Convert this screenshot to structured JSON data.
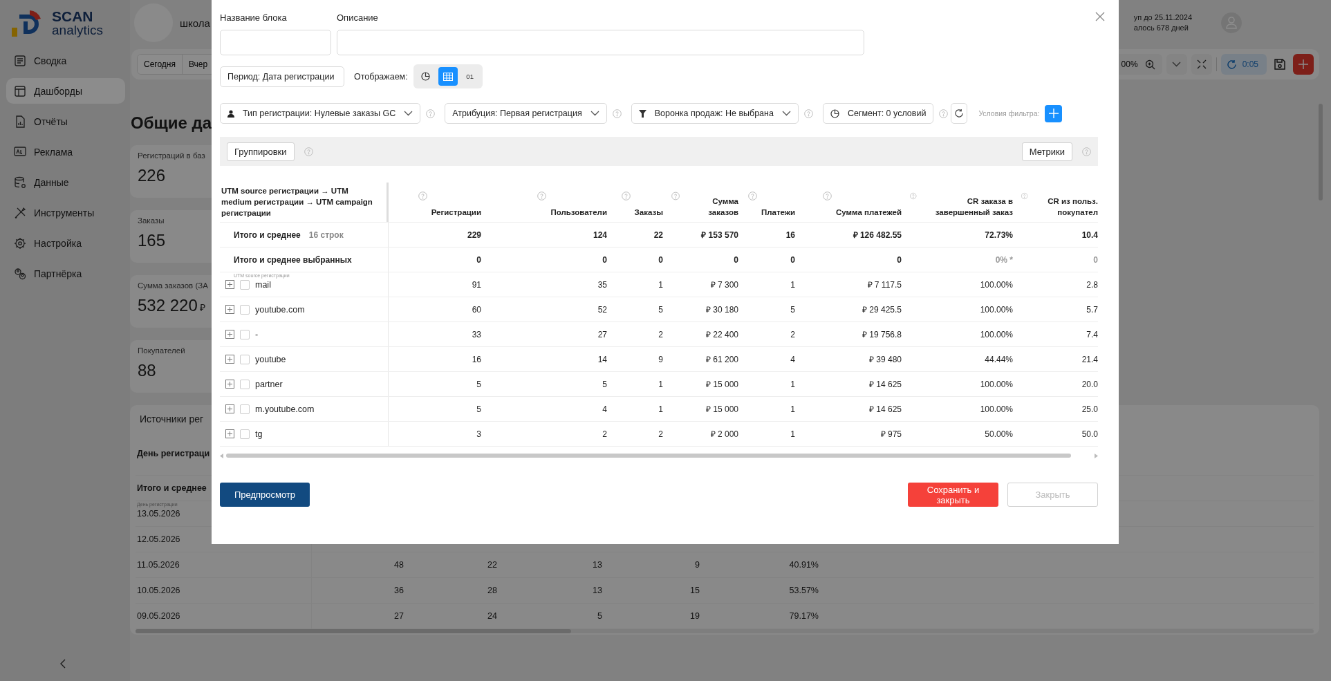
{
  "sidebar": {
    "logo": {
      "title": "SCAN",
      "subtitle": "analytics"
    },
    "items": [
      {
        "label": "Сводка",
        "selected": false
      },
      {
        "label": "Дашборды",
        "selected": true
      },
      {
        "label": "Отчёты",
        "selected": false
      },
      {
        "label": "Реклама",
        "selected": false
      },
      {
        "label": "Данные",
        "selected": false
      },
      {
        "label": "Инструменты",
        "selected": false
      },
      {
        "label": "Настройка",
        "selected": false
      },
      {
        "label": "Партнёрка",
        "selected": false
      }
    ]
  },
  "header": {
    "workspace": "школа",
    "access_lines": [
      "уп до 25.11.2024",
      "алось 678 дней"
    ]
  },
  "toolbar": {
    "periods": [
      "Сегодня",
      "Вчер"
    ],
    "zoom": "00%",
    "refresh_timer": "0:05"
  },
  "page_title": "Общие да",
  "kpi_cards": [
    {
      "label": "Регистраций в баз",
      "value": "226"
    },
    {
      "label": "Заказы",
      "value": "165"
    },
    {
      "label": "Сумма заказов (ЗА",
      "value": "532 220",
      "currency": "₽"
    },
    {
      "label": "Покупателей",
      "value": "88"
    }
  ],
  "sources_table": {
    "title": "Источники рег",
    "header": "День регистраци",
    "total_label": "Итого и среднее",
    "group_caption": "День регистрации",
    "rows": [
      {
        "date": "13.05.2026",
        "values": []
      },
      {
        "date": "12.05.2026",
        "values": []
      },
      {
        "date": "11.05.2026",
        "values": [
          "48",
          "22",
          "13",
          "9",
          "40.91%"
        ]
      },
      {
        "date": "10.05.2026",
        "values": [
          "36",
          "28",
          "13",
          "15",
          "53.57%"
        ]
      },
      {
        "date": "09.05.2026",
        "values": [
          "27",
          "24",
          "5",
          "19",
          "79.17%"
        ]
      }
    ]
  },
  "modal": {
    "name_label": "Название блока",
    "description_label": "Описание",
    "period_dropdown": "Период: Дата регистрации",
    "display": {
      "label": "Отображаем:",
      "options": [
        {
          "kind": "chart",
          "selected": false
        },
        {
          "kind": "table",
          "selected": true
        },
        {
          "kind": "text",
          "label": "01",
          "selected": false
        }
      ]
    },
    "filters": [
      {
        "label": "Тип регистрации: Нулевые заказы GC",
        "dropdown": true
      },
      {
        "label": "Атрибуция: Первая регистрация",
        "dropdown": true
      },
      {
        "label": "Воронка продаж: Не выбрана",
        "dropdown": true
      },
      {
        "label": "Сегмент: 0 условий",
        "dropdown": false
      }
    ],
    "filter_conditions_label": "Условия фильтра:",
    "groupings_button": "Группировки",
    "metrics_button": "Метрики",
    "table": {
      "group_header": "UTM source регистрации → UTM medium регистрации → UTM campaign регистрации",
      "columns": [
        "Регистрации",
        "Пользователи",
        "Заказы",
        "Сумма заказов",
        "Платежи",
        "Сумма платежей",
        "CR заказа в завершенный заказ",
        "CR из польз. покупател"
      ],
      "total_row": {
        "label": "Итого и среднее",
        "count": "16 строк",
        "values": [
          "229",
          "124",
          "22",
          "₽ 153 570",
          "16",
          "₽ 126 482.55",
          "72.73%",
          "10.4"
        ]
      },
      "selected_row": {
        "label": "Итого и среднее выбранных",
        "values": [
          {
            "text": "0",
            "muted": false
          },
          {
            "text": "0",
            "muted": false
          },
          {
            "text": "0",
            "muted": false
          },
          {
            "text": "0",
            "muted": false
          },
          {
            "text": "0",
            "muted": false
          },
          {
            "text": "0",
            "muted": false
          },
          {
            "text": "0% *",
            "muted": true
          },
          {
            "text": "0",
            "muted": true
          }
        ]
      },
      "level_caption": "UTM source регистрации",
      "rows": [
        {
          "label": "mail",
          "checked": false,
          "values": [
            "91",
            "35",
            "1",
            "₽ 7 300",
            "1",
            "₽ 7 117.5",
            "100.00%",
            "2.8"
          ]
        },
        {
          "label": "youtube.com",
          "checked": false,
          "values": [
            "60",
            "52",
            "5",
            "₽ 30 180",
            "5",
            "₽ 29 425.5",
            "100.00%",
            "5.7"
          ]
        },
        {
          "label": "-",
          "checked": false,
          "values": [
            "33",
            "27",
            "2",
            "₽ 22 400",
            "2",
            "₽ 19 756.8",
            "100.00%",
            "7.4"
          ]
        },
        {
          "label": "youtube",
          "checked": false,
          "values": [
            "16",
            "14",
            "9",
            "₽ 61 200",
            "4",
            "₽ 39 480",
            "44.44%",
            "21.4"
          ]
        },
        {
          "label": "partner",
          "checked": false,
          "values": [
            "5",
            "5",
            "1",
            "₽ 15 000",
            "1",
            "₽ 14 625",
            "100.00%",
            "20.0"
          ]
        },
        {
          "label": "m.youtube.com",
          "checked": false,
          "values": [
            "5",
            "4",
            "1",
            "₽ 15 000",
            "1",
            "₽ 14 625",
            "100.00%",
            "25.0"
          ]
        },
        {
          "label": "tg",
          "checked": false,
          "values": [
            "3",
            "2",
            "2",
            "₽ 2 000",
            "1",
            "₽ 975",
            "50.00%",
            "50.0"
          ]
        }
      ]
    },
    "buttons": [
      {
        "kind": "preview",
        "label": "Предпросмотр",
        "disabled": false
      },
      {
        "kind": "save",
        "label": "Сохранить и закрыть",
        "disabled": false
      },
      {
        "kind": "close",
        "label": "Закрыть",
        "disabled": true
      }
    ]
  }
}
